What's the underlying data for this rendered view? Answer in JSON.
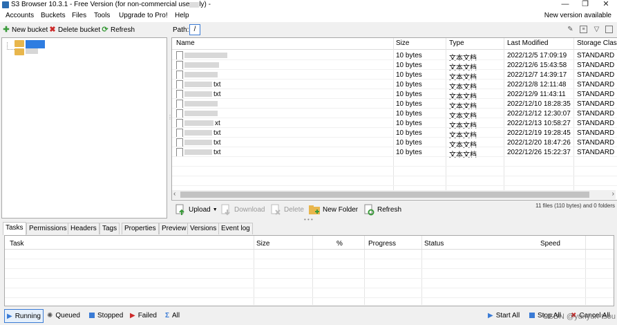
{
  "window": {
    "title": "S3 Browser 10.3.1 - Free Version (for non-commercial use only) - ",
    "controls": [
      "—",
      "❐",
      "✕"
    ]
  },
  "menu": {
    "items": [
      "Accounts",
      "Buckets",
      "Files",
      "Tools",
      "Upgrade to Pro!",
      "Help"
    ],
    "new_version": "New version available"
  },
  "left_toolbar": {
    "new_bucket": "New bucket",
    "delete_bucket": "Delete bucket",
    "refresh": "Refresh"
  },
  "pathbar": {
    "label": "Path:",
    "value": "/"
  },
  "file_list": {
    "columns": [
      "Name",
      "Size",
      "Type",
      "Last Modified",
      "Storage Class"
    ],
    "rows": [
      {
        "name": "",
        "size": "10 bytes",
        "type": "文本文档",
        "modified": "2022/12/5 17:09:19",
        "storage": "STANDARD"
      },
      {
        "name": "",
        "size": "10 bytes",
        "type": "文本文档",
        "modified": "2022/12/6 15:43:58",
        "storage": "STANDARD"
      },
      {
        "name": "",
        "size": "10 bytes",
        "type": "文本文档",
        "modified": "2022/12/7 14:39:17",
        "storage": "STANDARD"
      },
      {
        "name": "txt",
        "size": "10 bytes",
        "type": "文本文档",
        "modified": "2022/12/8 12:11:48",
        "storage": "STANDARD"
      },
      {
        "name": "txt",
        "size": "10 bytes",
        "type": "文本文档",
        "modified": "2022/12/9 11:43:11",
        "storage": "STANDARD"
      },
      {
        "name": "",
        "size": "10 bytes",
        "type": "文本文档",
        "modified": "2022/12/10 18:28:35",
        "storage": "STANDARD"
      },
      {
        "name": "",
        "size": "10 bytes",
        "type": "文本文档",
        "modified": "2022/12/12 12:30:07",
        "storage": "STANDARD"
      },
      {
        "name": "xt",
        "size": "10 bytes",
        "type": "文本文档",
        "modified": "2022/12/13 10:58:27",
        "storage": "STANDARD"
      },
      {
        "name": "txt",
        "size": "10 bytes",
        "type": "文本文档",
        "modified": "2022/12/19 19:28:45",
        "storage": "STANDARD"
      },
      {
        "name": "txt",
        "size": "10 bytes",
        "type": "文本文档",
        "modified": "2022/12/20 18:47:26",
        "storage": "STANDARD"
      },
      {
        "name": "txt",
        "size": "10 bytes",
        "type": "文本文档",
        "modified": "2022/12/26 15:22:37",
        "storage": "STANDARD"
      }
    ]
  },
  "actions": {
    "upload": "Upload",
    "download": "Download",
    "delete": "Delete",
    "new_folder": "New Folder",
    "refresh": "Refresh",
    "summary": "11 files (110 bytes) and 0 folders"
  },
  "tabs": [
    "Tasks",
    "Permissions",
    "Headers",
    "Tags",
    "Properties",
    "Preview",
    "Versions",
    "Event log"
  ],
  "task_list": {
    "columns": [
      "Task",
      "Size",
      "%",
      "Progress",
      "Status",
      "Speed"
    ]
  },
  "bottom": {
    "running": "Running",
    "queued": "Queued",
    "stopped": "Stopped",
    "failed": "Failed",
    "all": "All",
    "start_all": "Start All",
    "stop_all": "Stop All",
    "cancel_all": "Cancel All",
    "watermark": "CSDN @yunyun-tsou"
  },
  "colors": {
    "accent": "#3a7bd5",
    "selection": "#2f7de1",
    "folder": "#e8b64c",
    "green": "#3a9a3a",
    "red": "#cc2a2a"
  }
}
